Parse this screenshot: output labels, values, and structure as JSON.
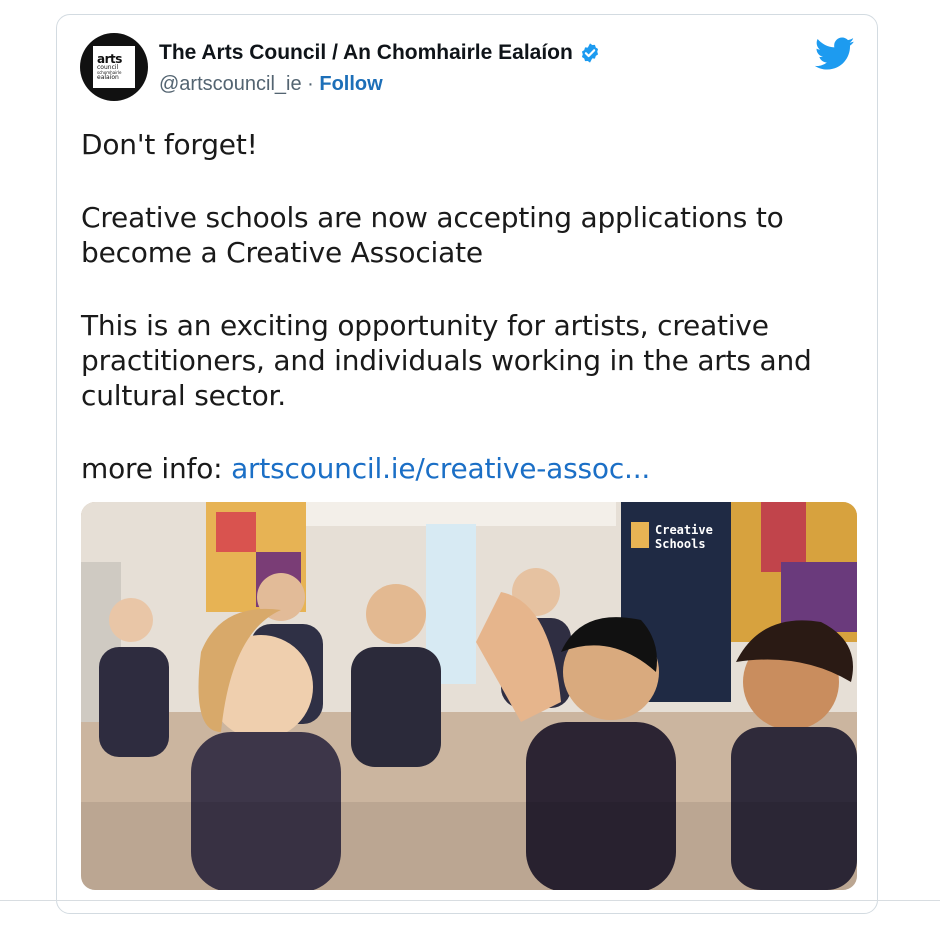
{
  "tweet": {
    "author": {
      "display_name": "The Arts Council / An Chomhairle Ealaíon",
      "handle": "@artscouncil_ie",
      "separator": " · ",
      "follow_label": "Follow",
      "avatar_text": [
        "arts",
        "council",
        "schomhairle",
        "ealaíon"
      ],
      "verified": true
    },
    "paragraphs": [
      "Don't forget!",
      "Creative schools are now accepting applications to become a Creative Associate",
      "This is an exciting opportunity for artists, creative practitioners, and individuals working in the arts and cultural sector."
    ],
    "more_info_label": "more info: ",
    "link_text": "artscouncil.ie/creative-assoc...",
    "photo": {
      "banner_text": [
        "Creative",
        "Schools"
      ]
    }
  },
  "colors": {
    "twitter_blue": "#1d9bf0",
    "link_blue": "#1b6fc6",
    "follow_blue": "#1d6fb8",
    "text": "#1a1a1a",
    "muted": "#536471",
    "border": "#d3dbe1"
  },
  "icons": {
    "brand": "twitter-bird-icon",
    "verified": "verified-badge-icon"
  }
}
